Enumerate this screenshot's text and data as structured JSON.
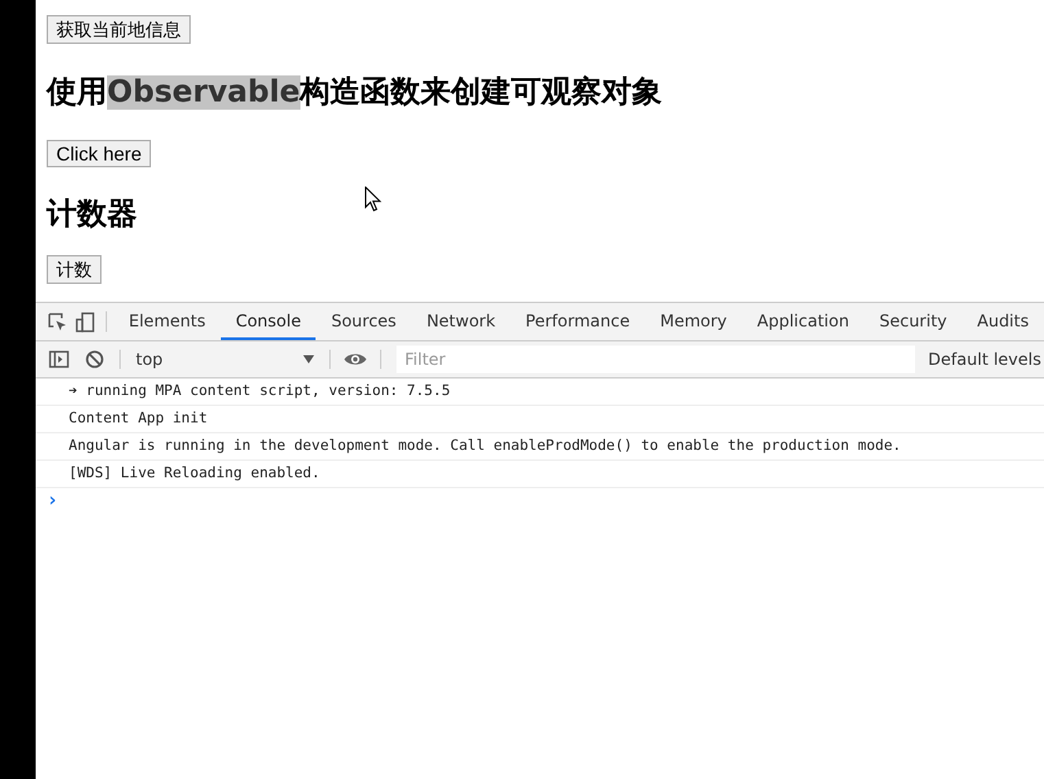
{
  "page": {
    "buttons_top": "获取当前地信息",
    "heading": [
      {
        "text": "使用",
        "highlighted": false
      },
      {
        "text": "Observable",
        "highlighted": true
      },
      {
        "text": "构造函数来创建可观察对象",
        "highlighted": false
      }
    ],
    "click_button": "Click here",
    "counter_heading": "计数器",
    "counter_button": "计数"
  },
  "devtools": {
    "tabs": [
      {
        "label": "Elements",
        "selected": false
      },
      {
        "label": "Console",
        "selected": true
      },
      {
        "label": "Sources",
        "selected": false
      },
      {
        "label": "Network",
        "selected": false
      },
      {
        "label": "Performance",
        "selected": false
      },
      {
        "label": "Memory",
        "selected": false
      },
      {
        "label": "Application",
        "selected": false
      },
      {
        "label": "Security",
        "selected": false
      },
      {
        "label": "Audits",
        "selected": false
      }
    ],
    "context": "top",
    "filter": {
      "placeholder": "Filter"
    },
    "levels": "Default levels",
    "messages": [
      "➔ running MPA content script, version: 7.5.5",
      "Content App init",
      "Angular is running in the development mode. Call enableProdMode() to enable the production mode.",
      "[WDS] Live Reloading enabled."
    ],
    "prompt": "›"
  }
}
